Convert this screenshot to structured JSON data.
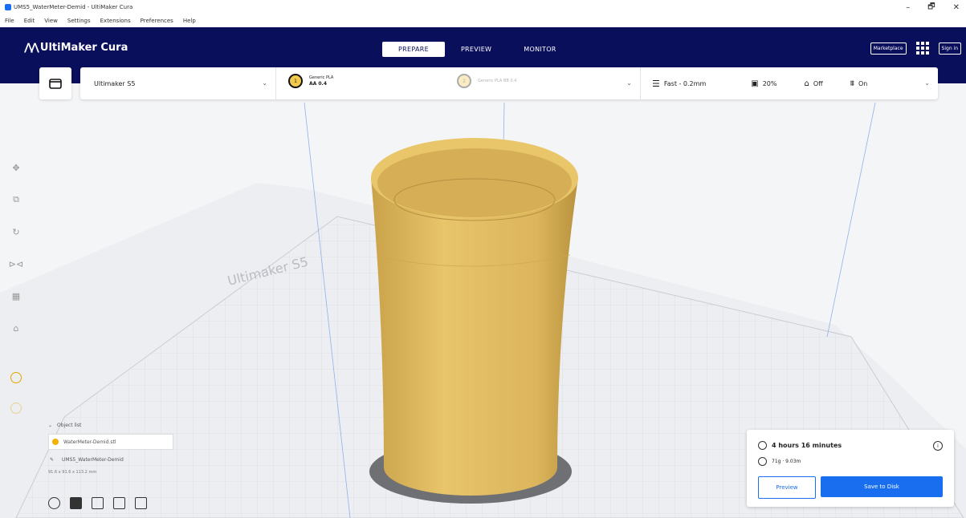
{
  "window": {
    "title": "UMS5_WaterMeter-Demid - UltiMaker Cura",
    "minimize": "–",
    "maximize": "🗗",
    "close": "✕"
  },
  "menu": [
    "File",
    "Edit",
    "View",
    "Settings",
    "Extensions",
    "Preferences",
    "Help"
  ],
  "header": {
    "logo_text": "UltiMaker Cura",
    "tabs": [
      "PREPARE",
      "PREVIEW",
      "MONITOR"
    ],
    "active_tab": "PREPARE",
    "marketplace": "Marketplace",
    "signin": "Sign in"
  },
  "toolbar": {
    "printer": "Ultimaker S5",
    "extruder1": {
      "name": "Generic PLA",
      "core": "AA 0.4",
      "number": "1"
    },
    "extruder2": {
      "name": "Generic PLA",
      "core": "BB 0.4",
      "number": "2"
    },
    "profile": "Fast - 0.2mm",
    "infill": "20%",
    "support": "Off",
    "adhesion": "On"
  },
  "scene": {
    "build_plate_label": "Ultimaker S5"
  },
  "object_list": {
    "heading": "Object list",
    "file": "WaterMeter-Demid.stl",
    "job_name": "UMS5_WaterMeter-Demid",
    "dimensions": "91.6 x 91.6 x 113.2 mm"
  },
  "summary": {
    "print_time": "4 hours 16 minutes",
    "material_usage": "71g · 9.03m",
    "preview_label": "Preview",
    "save_label": "Save to Disk"
  },
  "colors": {
    "header_bg": "#0a0f5c",
    "accent": "#196ef0",
    "model": "#f2c94c"
  }
}
